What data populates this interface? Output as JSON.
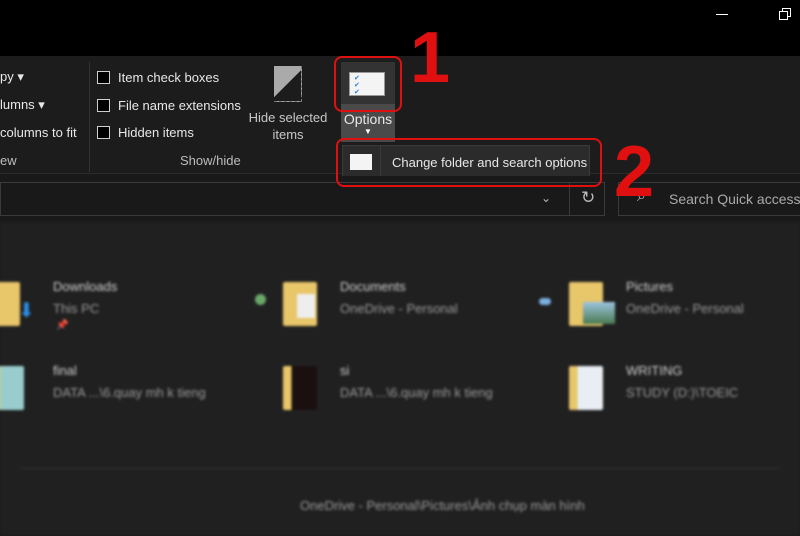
{
  "window": {
    "minimize_icon": "minimize-icon",
    "restore_icon": "restore-icon"
  },
  "ribbon": {
    "layout_items": [
      "py",
      "lumns",
      "columns to fit"
    ],
    "layout_group": "ew",
    "checkboxes": [
      {
        "label": "Item check boxes",
        "checked": false
      },
      {
        "label": "File name extensions",
        "checked": false
      },
      {
        "label": "Hidden items",
        "checked": false
      }
    ],
    "hide_selected": [
      "Hide selected",
      "items"
    ],
    "show_hide_group": "Show/hide",
    "options_label": "Options",
    "menu_item": "Change folder and search options"
  },
  "annotations": {
    "step1": "1",
    "step2": "2",
    "color": "#e01010"
  },
  "search": {
    "placeholder": "Search Quick access"
  },
  "folders": [
    {
      "name": "Downloads",
      "location": "This PC"
    },
    {
      "name": "Documents",
      "location": "OneDrive - Personal"
    },
    {
      "name": "Pictures",
      "location": "OneDrive - Personal"
    },
    {
      "name": "final",
      "location": "DATA ...\\6.quay mh k tieng"
    },
    {
      "name": "si",
      "location": "DATA ...\\6.quay mh k tieng"
    },
    {
      "name": "WRITING",
      "location": "STUDY (D:)\\TOEIC"
    }
  ],
  "recent": {
    "path1": "OneDrive - Personal\\Pictures\\Ảnh chụp màn hình"
  }
}
